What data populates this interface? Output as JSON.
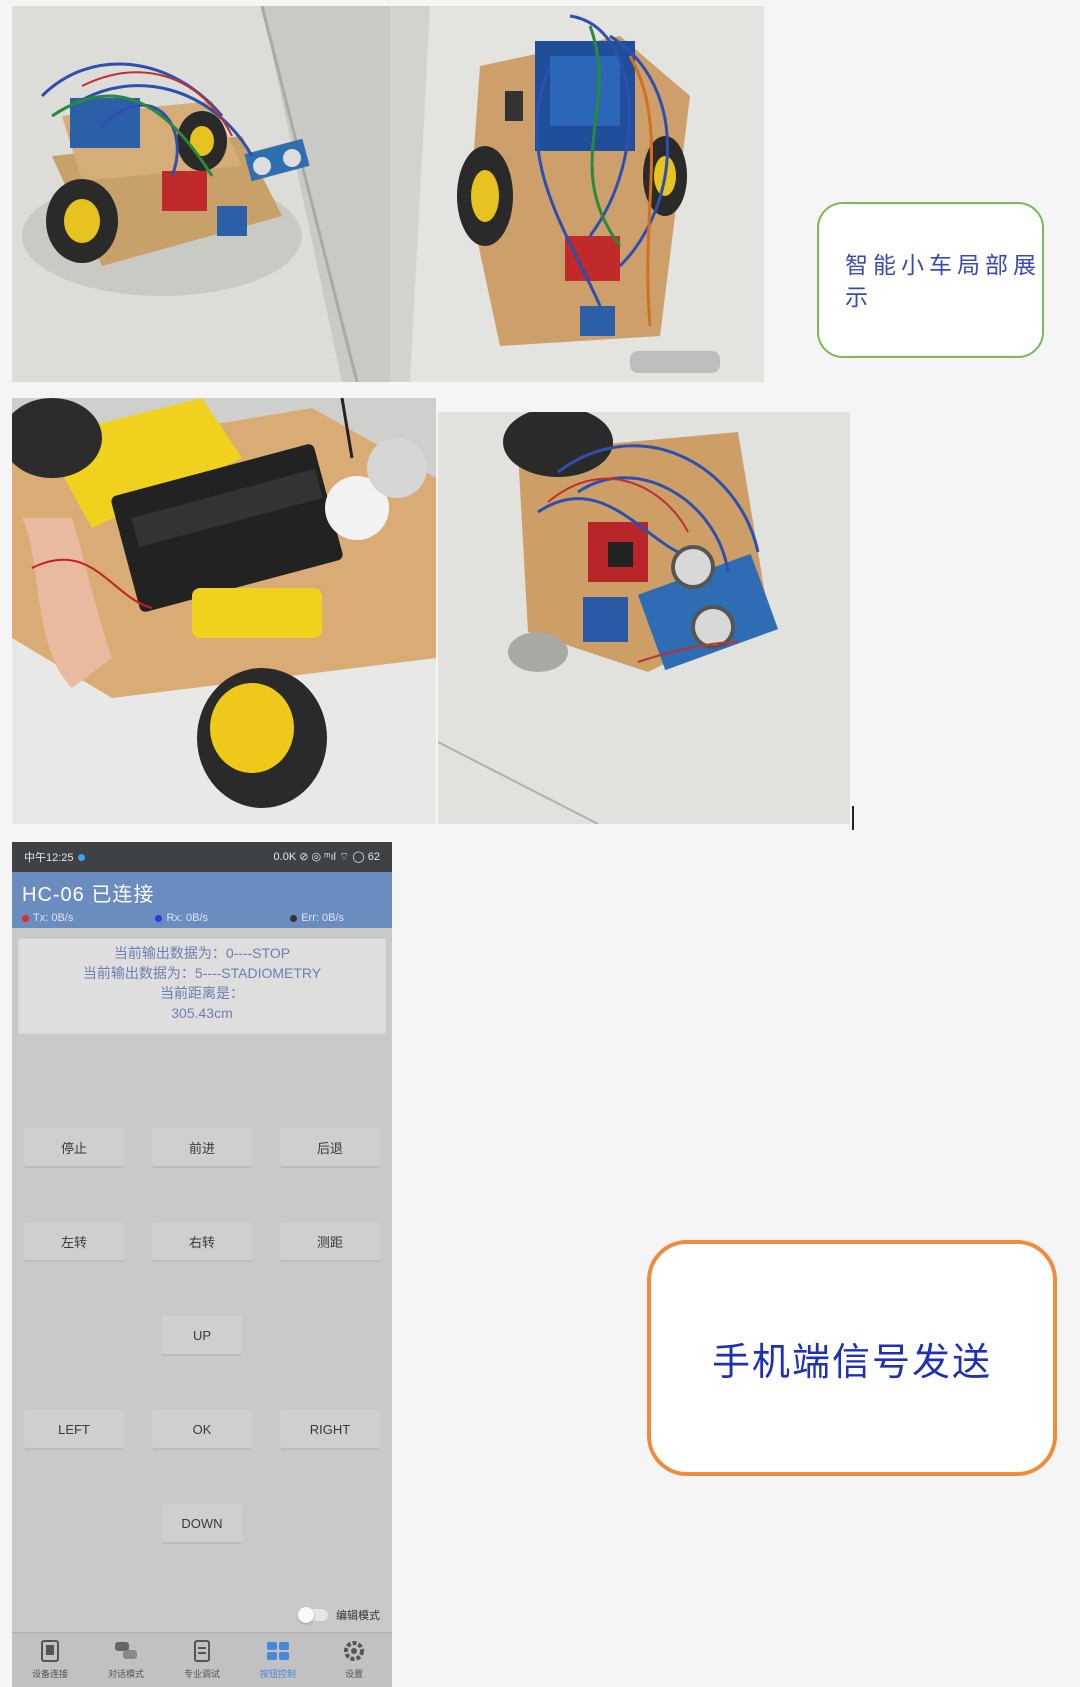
{
  "callouts": {
    "car_display": "智能小车局部展示",
    "phone_send": "手机端信号发送"
  },
  "phone": {
    "status_bar": {
      "time": "中午12:25",
      "right": "0.0K ⊘ ◎ ᵐıl ⌔ ◯ 62"
    },
    "device_title": "HC-06 已连接",
    "rates": [
      {
        "label": "Tx: 0B/s",
        "color": "#e02b2b"
      },
      {
        "label": "Rx: 0B/s",
        "color": "#2b3de0"
      },
      {
        "label": "Err: 0B/s",
        "color": "#333333"
      }
    ],
    "output": {
      "line1": "当前输出数据为：0----STOP",
      "line2": "当前输出数据为：5----STADIOMETRY",
      "line3": "当前距离是：",
      "distance": "305.43cm"
    },
    "buttons": {
      "stop": "停止",
      "forward": "前进",
      "back": "后退",
      "left_turn": "左转",
      "right_turn": "右转",
      "measure": "测距",
      "up": "UP",
      "left": "LEFT",
      "ok": "OK",
      "right": "RIGHT",
      "down": "DOWN"
    },
    "edit_mode": "编辑模式",
    "nav": [
      {
        "label": "设备连接",
        "icon": "phone-device-icon"
      },
      {
        "label": "对话模式",
        "icon": "chat-bubbles-icon"
      },
      {
        "label": "专业调试",
        "icon": "debug-panel-icon"
      },
      {
        "label": "按钮控制",
        "icon": "grid-buttons-icon"
      },
      {
        "label": "设置",
        "icon": "gear-icon"
      }
    ]
  }
}
